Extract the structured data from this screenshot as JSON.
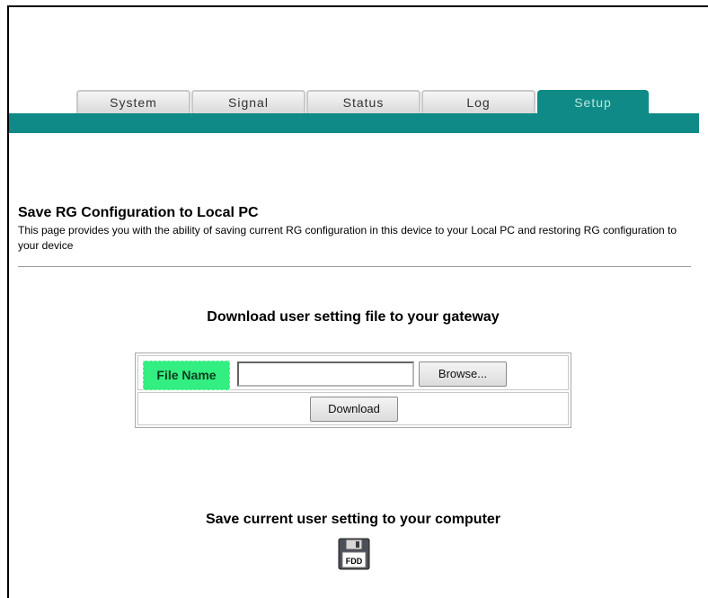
{
  "tabs": [
    {
      "label": "System"
    },
    {
      "label": "Signal"
    },
    {
      "label": "Status"
    },
    {
      "label": "Log"
    },
    {
      "label": "Setup",
      "active": true
    }
  ],
  "page": {
    "title": "Save RG Configuration to Local PC",
    "description": "This page provides you with the ability of saving current RG configuration in this device to your Local PC and restoring RG configuration to your device"
  },
  "download_section": {
    "heading": "Download user setting file to your gateway",
    "file_label": "File Name",
    "file_value": "",
    "browse_label": "Browse...",
    "download_label": "Download"
  },
  "save_section": {
    "heading": "Save current user setting to your computer",
    "icon": "floppy-disk-icon",
    "icon_text": "FDD"
  },
  "colors": {
    "accent": "#0f8a86",
    "file_label_bg": "#33ee80"
  }
}
